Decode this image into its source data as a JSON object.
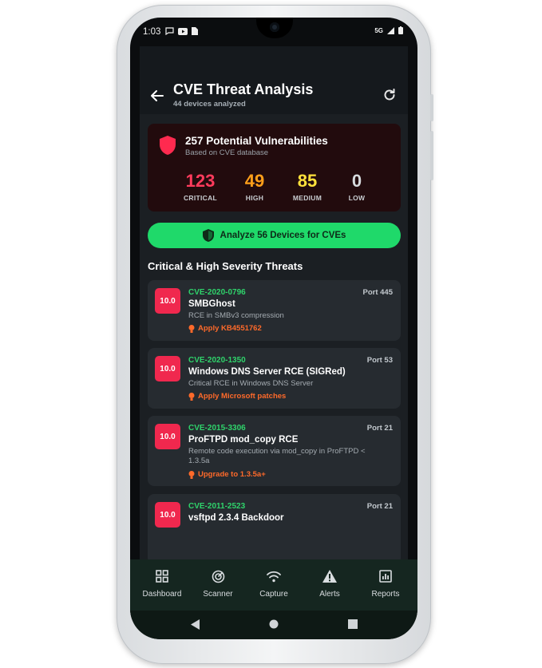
{
  "status_bar": {
    "time": "1:03",
    "network": "5G"
  },
  "app_bar": {
    "title": "CVE Threat Analysis",
    "subtitle": "44 devices analyzed"
  },
  "summary": {
    "title": "257 Potential Vulnerabilities",
    "subtitle": "Based on CVE database",
    "stats": [
      {
        "value": "123",
        "label": "CRITICAL",
        "color": "#ff3b5c"
      },
      {
        "value": "49",
        "label": "HIGH",
        "color": "#ff9f1a"
      },
      {
        "value": "85",
        "label": "MEDIUM",
        "color": "#ffe13b"
      },
      {
        "value": "0",
        "label": "LOW",
        "color": "#d7dbde"
      }
    ]
  },
  "analyze_button": {
    "label": "Analyze 56 Devices for CVEs"
  },
  "section_title": "Critical & High Severity Threats",
  "threats": [
    {
      "score": "10.0",
      "cve": "CVE-2020-0796",
      "port": "Port 445",
      "name": "SMBGhost",
      "description": "RCE in SMBv3 compression",
      "fix": "Apply KB4551762"
    },
    {
      "score": "10.0",
      "cve": "CVE-2020-1350",
      "port": "Port 53",
      "name": "Windows DNS Server RCE (SIGRed)",
      "description": "Critical RCE in Windows DNS Server",
      "fix": "Apply Microsoft patches"
    },
    {
      "score": "10.0",
      "cve": "CVE-2015-3306",
      "port": "Port 21",
      "name": "ProFTPD mod_copy RCE",
      "description": "Remote code execution via mod_copy in ProFTPD < 1.3.5a",
      "fix": "Upgrade to 1.3.5a+"
    },
    {
      "score": "10.0",
      "cve": "CVE-2011-2523",
      "port": "Port 21",
      "name": "vsftpd 2.3.4 Backdoor",
      "description": "",
      "fix": ""
    }
  ],
  "bottom_nav": [
    {
      "label": "Dashboard",
      "icon": "dashboard-icon"
    },
    {
      "label": "Scanner",
      "icon": "scanner-icon"
    },
    {
      "label": "Capture",
      "icon": "wifi-capture-icon"
    },
    {
      "label": "Alerts",
      "icon": "alert-triangle-icon"
    },
    {
      "label": "Reports",
      "icon": "reports-icon"
    }
  ],
  "colors": {
    "accent_green": "#1fd96a",
    "critical_red": "#f0284e",
    "fix_orange": "#ff6a2a"
  }
}
